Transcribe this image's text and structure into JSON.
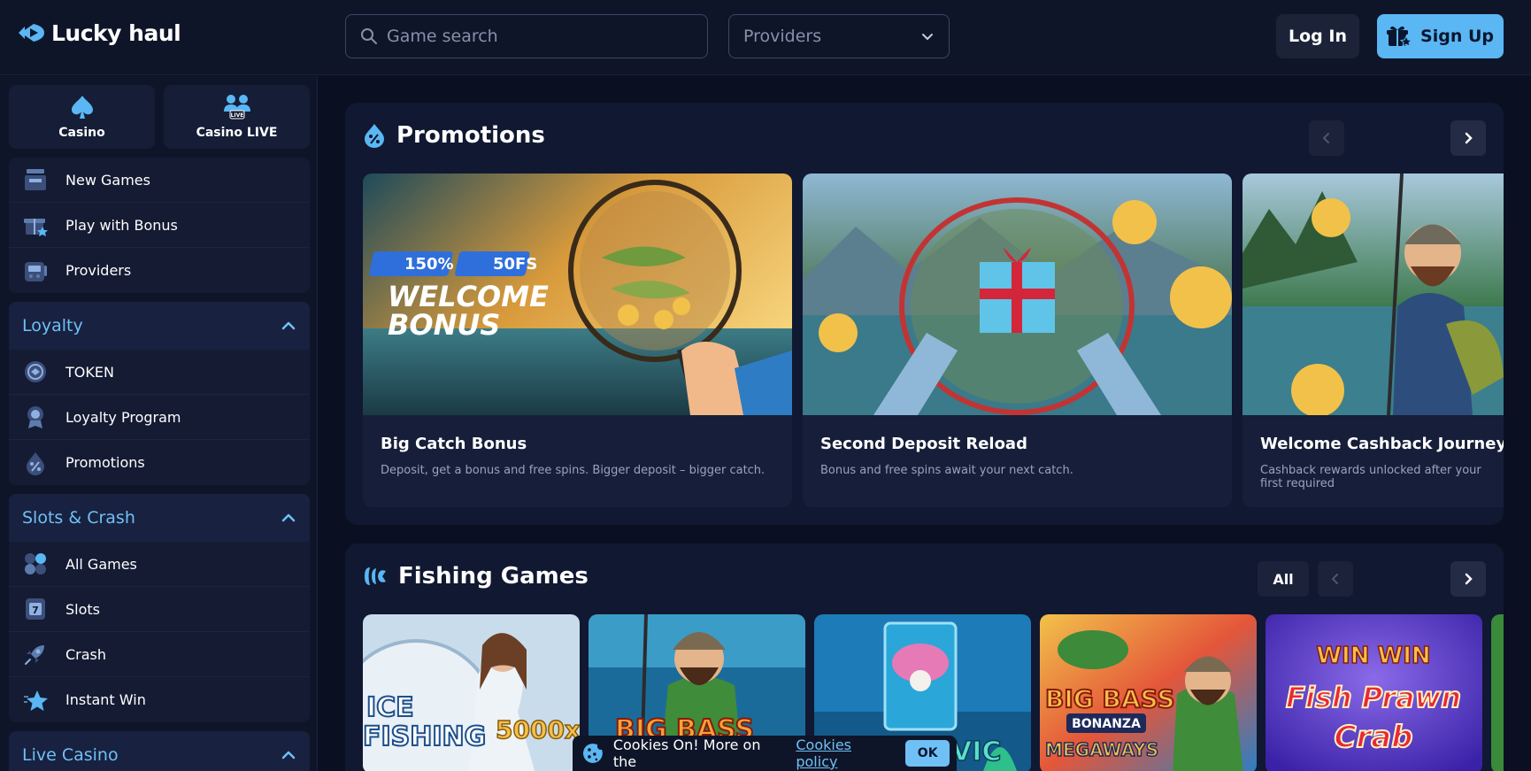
{
  "brand": {
    "name": "Lucky haul",
    "accent": "#5ab7f3"
  },
  "header": {
    "search_placeholder": "Game search",
    "providers_label": "Providers",
    "login_label": "Log In",
    "signup_label": "Sign Up"
  },
  "sidebar": {
    "modes": [
      {
        "label": "Casino",
        "icon": "spade-icon"
      },
      {
        "label": "Casino LIVE",
        "icon": "live-users-icon",
        "badge": "LIVE"
      }
    ],
    "main_items": [
      {
        "label": "New Games",
        "icon": "new-games-icon"
      },
      {
        "label": "Play with Bonus",
        "icon": "gift-icon"
      },
      {
        "label": "Providers",
        "icon": "providers-icon"
      }
    ],
    "loyalty": {
      "title": "Loyalty",
      "items": [
        {
          "label": "TOKEN",
          "icon": "token-icon"
        },
        {
          "label": "Loyalty Program",
          "icon": "medal-icon"
        },
        {
          "label": "Promotions",
          "icon": "percent-icon"
        }
      ]
    },
    "slots": {
      "title": "Slots & Crash",
      "items": [
        {
          "label": "All Games",
          "icon": "all-games-icon"
        },
        {
          "label": "Slots",
          "icon": "slot-machine-icon"
        },
        {
          "label": "Crash",
          "icon": "rocket-icon"
        },
        {
          "label": "Instant Win",
          "icon": "star-icon"
        }
      ]
    },
    "live": {
      "title": "Live Casino"
    }
  },
  "promotions": {
    "title": "Promotions",
    "cards": [
      {
        "title": "Big Catch Bonus",
        "desc": "Deposit, get a bonus and free spins. Bigger deposit – bigger catch.",
        "badge1": "150%",
        "badge2": "50FS",
        "headline1": "WELCOME",
        "headline2": "BONUS"
      },
      {
        "title": "Second Deposit Reload",
        "desc": "Bonus and free spins await your next catch."
      },
      {
        "title": "Welcome Cashback Journey",
        "desc": "Cashback rewards unlocked after your first required"
      }
    ]
  },
  "fishing": {
    "title": "Fishing Games",
    "all_label": "All",
    "games": [
      {
        "art1": "ICE",
        "art2": "FISHING",
        "art3": "5000x"
      },
      {
        "art1": "BIG BASS"
      },
      {
        "art1": "VIC"
      },
      {
        "art1": "BIG BASS",
        "art2": "BONANZA",
        "art3": "MEGAWAYS"
      },
      {
        "art1": "WIN WIN",
        "art2": "Fish Prawn",
        "art3": "Crab"
      }
    ]
  },
  "cookies": {
    "text": "Cookies On! More on the",
    "link": "Cookies policy",
    "ok": "OK"
  }
}
